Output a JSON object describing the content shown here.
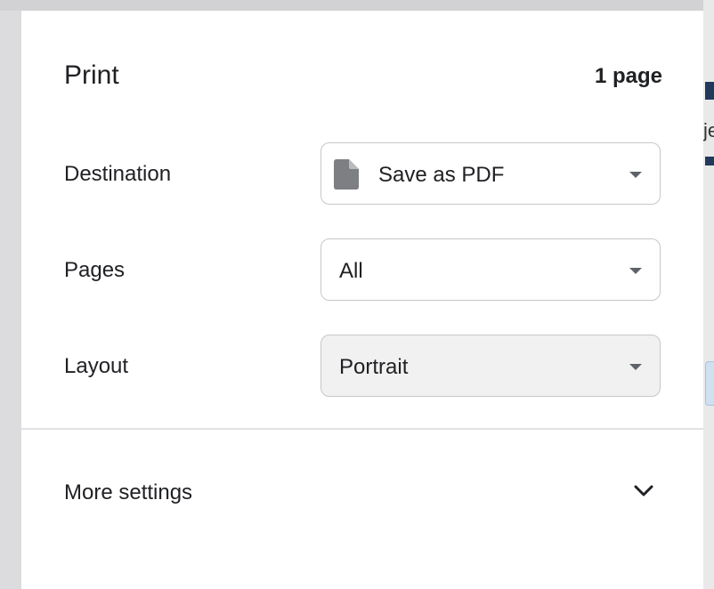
{
  "dialog": {
    "title": "Print",
    "page_count": "1 page"
  },
  "destination": {
    "label": "Destination",
    "value": "Save as PDF",
    "icon": "file-icon"
  },
  "pages": {
    "label": "Pages",
    "value": "All"
  },
  "layout": {
    "label": "Layout",
    "value": "Portrait"
  },
  "more_settings": {
    "label": "More settings",
    "icon": "chevron-down-icon"
  },
  "background": {
    "partial_text": "je"
  },
  "colors": {
    "text": "#202124",
    "icon_gray": "#5f6368",
    "border": "#c7c7c9",
    "disabled_bg": "#f1f1f1",
    "background_nav": "#22395c"
  }
}
